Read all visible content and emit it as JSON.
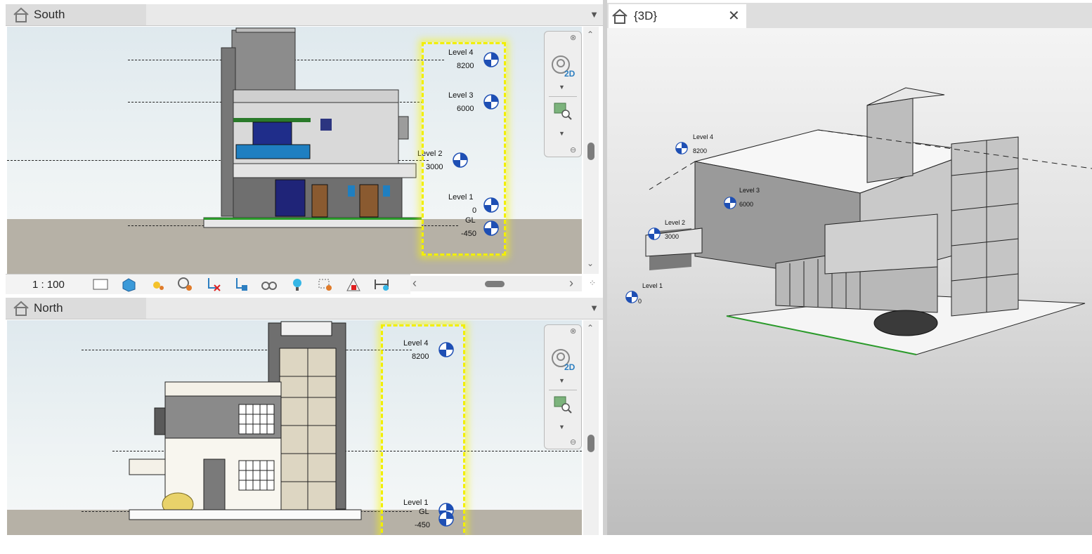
{
  "views": {
    "south": {
      "title": "South",
      "scale": "1 : 100",
      "levels": [
        {
          "name": "Level 4",
          "value": "8200"
        },
        {
          "name": "Level 3",
          "value": "6000"
        },
        {
          "name": "Level 2",
          "value": "3000"
        },
        {
          "name": "Level 1",
          "value": "0"
        },
        {
          "name": "GL",
          "value": "-450"
        }
      ]
    },
    "north": {
      "title": "North",
      "levels": [
        {
          "name": "Level 4",
          "value": "8200"
        },
        {
          "name": "Level 1",
          "value": "GL"
        },
        {
          "name": "",
          "value": "-450"
        }
      ]
    },
    "three_d": {
      "title": "{3D}",
      "levels": [
        {
          "name": "Level 4",
          "value": "8200"
        },
        {
          "name": "Level 3",
          "value": "6000"
        },
        {
          "name": "Level 2",
          "value": "3000"
        },
        {
          "name": "Level 1",
          "value": "0"
        }
      ]
    }
  },
  "navbar": {
    "mode_label": "2D"
  },
  "icons": {
    "tab": "home-icon",
    "close": "close-icon",
    "statusbar": [
      "detail-level-icon",
      "visual-style-icon",
      "sun-path-icon",
      "shadows-icon",
      "crop-view-icon",
      "show-crop-region-icon",
      "temporary-hide-icon",
      "reveal-hidden-icon",
      "lighting-icon",
      "worksharing-icon",
      "analytical-model-icon",
      "highlight-displacement-icon"
    ]
  },
  "colors": {
    "highlight": "#f2ef00",
    "level_marker": "#1e4fb4"
  }
}
